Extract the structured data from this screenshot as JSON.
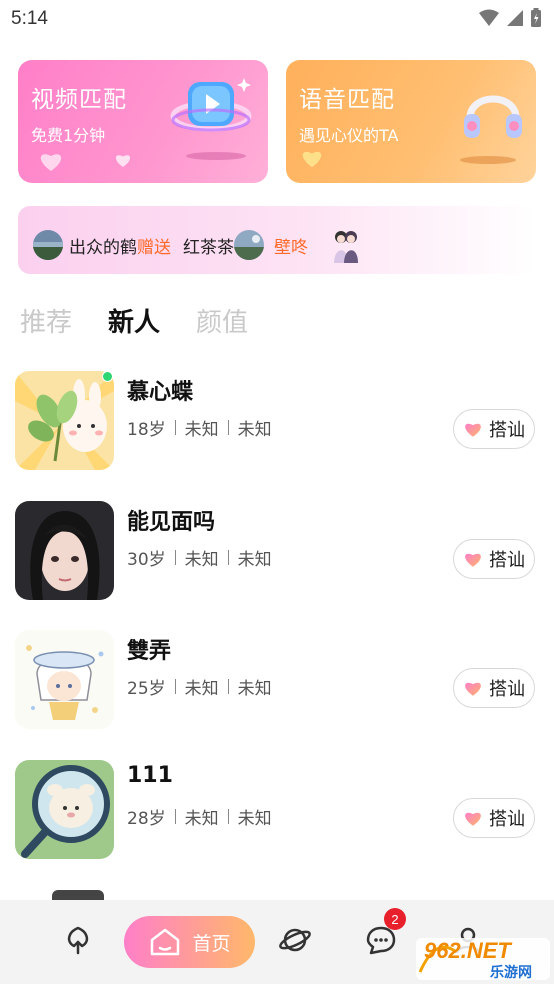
{
  "status_bar": {
    "time": "5:14"
  },
  "match_cards": {
    "video": {
      "title": "视频匹配",
      "subtitle": "免费1分钟"
    },
    "voice": {
      "title": "语音匹配",
      "subtitle": "遇见心仪的TA"
    }
  },
  "gift_banner": {
    "sender": "出众的鹤",
    "action": "赠送",
    "receiver": "红茶茶",
    "gift": "壁咚"
  },
  "tabs": [
    {
      "label": "推荐",
      "active": false
    },
    {
      "label": "新人",
      "active": true
    },
    {
      "label": "颜值",
      "active": false
    }
  ],
  "users": [
    {
      "name": "慕心蝶",
      "age": "18岁",
      "field2": "未知",
      "field3": "未知",
      "online": true,
      "button": "搭讪"
    },
    {
      "name": "能见面吗",
      "age": "30岁",
      "field2": "未知",
      "field3": "未知",
      "online": false,
      "button": "搭讪"
    },
    {
      "name": "雙弄",
      "age": "25岁",
      "field2": "未知",
      "field3": "未知",
      "online": false,
      "button": "搭讪"
    },
    {
      "name": "111",
      "age": "28岁",
      "field2": "未知",
      "field3": "未知",
      "online": false,
      "button": "搭讪"
    }
  ],
  "bottom_nav": {
    "home_label": "首页",
    "message_badge": "2",
    "icons": [
      "tree-icon",
      "home-icon",
      "planet-icon",
      "chat-icon",
      "profile-icon"
    ]
  },
  "watermark": {
    "brand": "962.NET",
    "text": "乐游网"
  },
  "colors": {
    "video_card": "#ff8fcd",
    "voice_card": "#ffba6c",
    "gift_highlight": "#ff6a2a",
    "online": "#2ed573",
    "badge": "#e8202c"
  }
}
